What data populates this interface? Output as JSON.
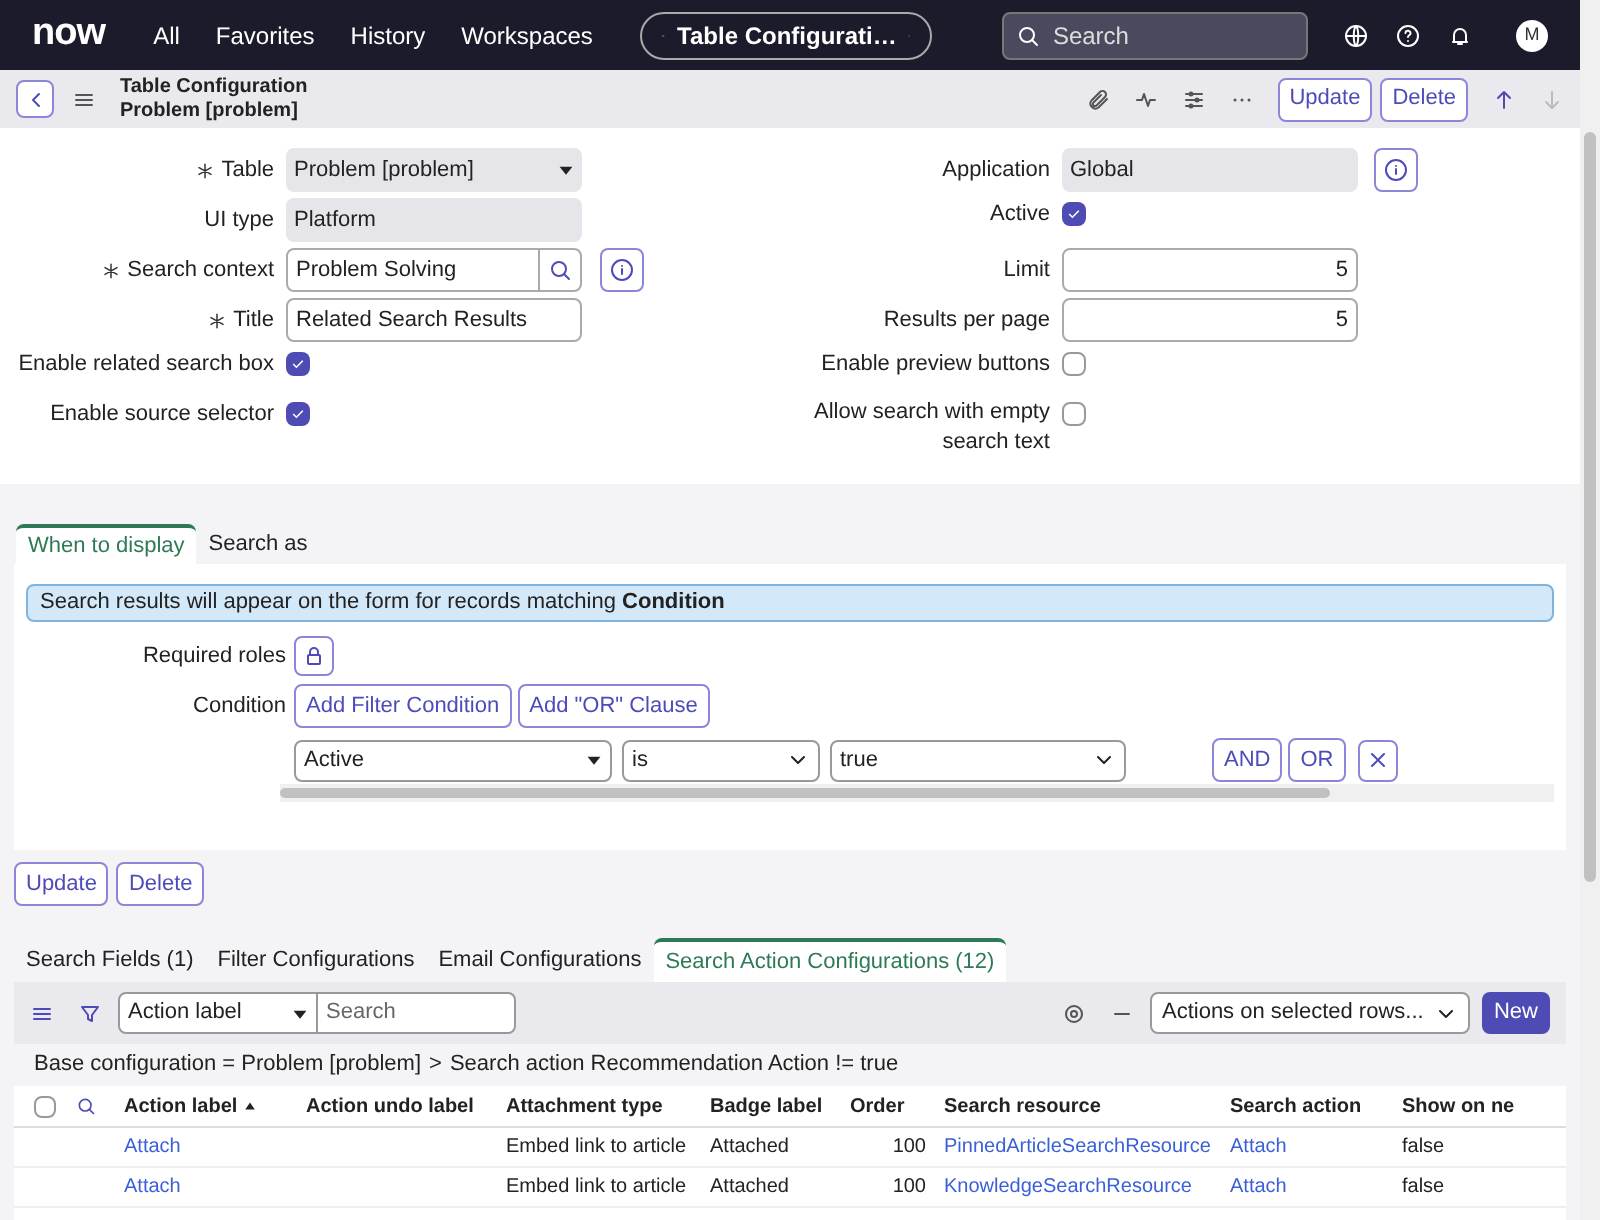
{
  "nav": {
    "logo": "now",
    "items": [
      "All",
      "Favorites",
      "History",
      "Workspaces"
    ],
    "title_pill": "Table Configurati…",
    "search_placeholder": "Search",
    "avatar": "M"
  },
  "header": {
    "title": "Table Configuration",
    "subtitle": "Problem [problem]",
    "buttons": [
      "Update",
      "Delete"
    ]
  },
  "form_left": [
    {
      "kind": "select",
      "label": "Table",
      "required": true,
      "value": "Problem [problem]"
    },
    {
      "kind": "readonly",
      "label": "UI type",
      "required": false,
      "value": "Platform"
    },
    {
      "kind": "lookup",
      "label": "Search context",
      "required": true,
      "value": "Problem Solving"
    },
    {
      "kind": "text",
      "label": "Title",
      "required": true,
      "value": "Related Search Results"
    },
    {
      "kind": "checkbox",
      "label": "Enable related search box",
      "required": false,
      "checked": true
    },
    {
      "kind": "checkbox",
      "label": "Enable source selector",
      "required": false,
      "checked": true
    }
  ],
  "form_right": [
    {
      "kind": "readonly_info",
      "label": "Application",
      "value": "Global"
    },
    {
      "kind": "checkbox",
      "label": "Active",
      "checked": true
    },
    {
      "kind": "number",
      "label": "Limit",
      "value": "5"
    },
    {
      "kind": "number",
      "label": "Results per page",
      "value": "5"
    },
    {
      "kind": "checkbox",
      "label": "Enable preview buttons",
      "checked": false
    },
    {
      "kind": "checkbox",
      "label": "Allow search with empty search text",
      "checked": false
    }
  ],
  "section_tabs": [
    {
      "label": "When to display",
      "selected": true
    },
    {
      "label": "Search as",
      "selected": false
    }
  ],
  "banner": "Search results will appear on the form for records matching **Condition**",
  "roles_label": "Required roles",
  "condition": {
    "label": "Condition",
    "buttons": [
      "Add Filter Condition",
      "Add \"OR\" Clause"
    ],
    "field": "Active",
    "operator": "is",
    "value": "true",
    "logic_buttons": [
      "AND",
      "OR"
    ]
  },
  "form_buttons": [
    "Update",
    "Delete"
  ],
  "related_tabs": [
    {
      "label": "Search Fields (1)",
      "selected": false
    },
    {
      "label": "Filter Configurations",
      "selected": false
    },
    {
      "label": "Email Configurations",
      "selected": false
    },
    {
      "label": "Search Action Configurations (12)",
      "selected": true
    }
  ],
  "list": {
    "search_field": "Action label",
    "search_placeholder": "Search",
    "actions": "Actions on selected rows...",
    "new_button": "New",
    "breadcrumb": [
      "Base configuration = Problem [problem]",
      "Search action Recommendation Action != true"
    ],
    "breadcrumb_separator": ">",
    "select_all_checked": false,
    "columns": [
      {
        "label": "Action label",
        "sorted": true
      },
      {
        "label": "Action undo label",
        "sorted": false
      },
      {
        "label": "Attachment type",
        "sorted": false
      },
      {
        "label": "Badge label",
        "sorted": false
      },
      {
        "label": "Order",
        "sorted": false
      },
      {
        "label": "Search resource",
        "sorted": false
      },
      {
        "label": "Search action",
        "sorted": false
      },
      {
        "label": "Show on ne",
        "sorted": false
      }
    ],
    "rows": [
      {
        "cells": [
          {
            "kind": "link",
            "text": "Attach"
          },
          {
            "kind": "empty"
          },
          {
            "kind": "text",
            "text": "Embed link to article"
          },
          {
            "kind": "text",
            "text": "Attached"
          },
          {
            "kind": "number",
            "text": "100"
          },
          {
            "kind": "link",
            "text": "PinnedArticleSearchResource"
          },
          {
            "kind": "link",
            "text": "Attach"
          },
          {
            "kind": "text",
            "text": "false"
          }
        ]
      },
      {
        "cells": [
          {
            "kind": "link",
            "text": "Attach"
          },
          {
            "kind": "empty"
          },
          {
            "kind": "text",
            "text": "Embed link to article"
          },
          {
            "kind": "text",
            "text": "Attached"
          },
          {
            "kind": "number",
            "text": "100"
          },
          {
            "kind": "link",
            "text": "KnowledgeSearchResource"
          },
          {
            "kind": "link",
            "text": "Attach"
          },
          {
            "kind": "text",
            "text": "false"
          }
        ]
      }
    ]
  }
}
